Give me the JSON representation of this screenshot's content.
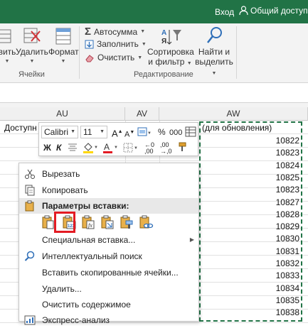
{
  "titlebar": {
    "login_label": "Вход",
    "share_label": "Общий доступ",
    "bg_color": "#217346"
  },
  "ribbon": {
    "insert_partial": "вить",
    "delete_label": "Удалить",
    "format_label": "Формат",
    "cells_group": "Ячейки",
    "autosum_label": "Автосумма",
    "fill_label": "Заполнить",
    "clear_label": "Очистить",
    "sort_label_1": "Сортировка",
    "sort_label_2": "и фильтр",
    "find_label_1": "Найти и",
    "find_label_2": "выделить",
    "editing_group": "Редактирование"
  },
  "columns": {
    "au": "AU",
    "av": "AV",
    "aw": "AW"
  },
  "cells": {
    "au_header_text": "Доступн",
    "aw_header_text": "(для обновления)",
    "aw_values": [
      "10822",
      "10823",
      "10824",
      "10825",
      "10823",
      "10827",
      "10828",
      "10829",
      "10830",
      "10831",
      "10832",
      "10833",
      "10834",
      "10835",
      "10838"
    ]
  },
  "mini_toolbar": {
    "font": "Calibri",
    "size": "11",
    "percent": "%",
    "thousands": "000",
    "bold": "Ж",
    "italic": "К",
    "font_color": "#e31b23",
    "fill_color": "#ffd700"
  },
  "context_menu": {
    "cut": "Вырезать",
    "copy": "Копировать",
    "paste_options": "Параметры вставки:",
    "paste_special": "Специальная вставка...",
    "smart_lookup": "Интеллектуальный поиск",
    "insert_copied": "Вставить скопированные ячейки...",
    "delete": "Удалить...",
    "clear_contents": "Очистить содержимое",
    "quick_analysis": "Экспресс-анализ"
  },
  "highlight_color": "#e31b23"
}
